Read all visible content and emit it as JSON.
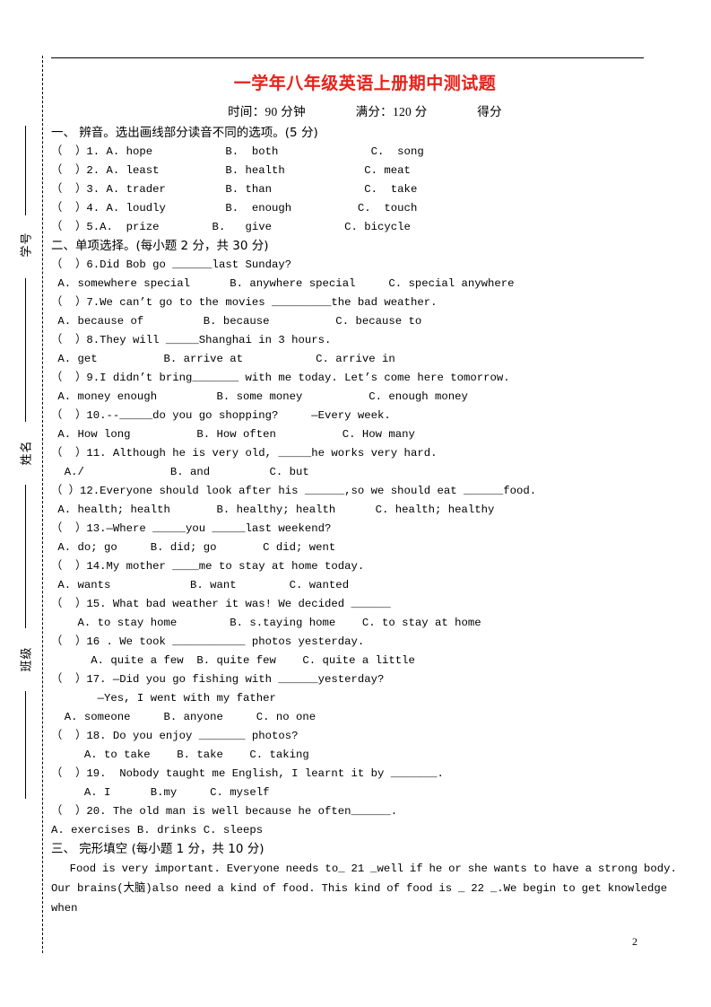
{
  "document": {
    "title": "一学年八年级英语上册期中测试题",
    "title_color": "#e8201a",
    "page_number": "2",
    "score_line": {
      "time": "时间：90 分钟",
      "full_marks": "满分：120 分",
      "score": "得分"
    }
  },
  "seal_margin": {
    "labels": [
      "学号",
      "姓名",
      "班级"
    ]
  },
  "sections": [
    {
      "heading": "一、 辨音。选出画线部分读音不同的选项。(5 分)",
      "questions": [
        {
          "stem": "（  ）1. A. hope           B.  both              C.  song",
          "options": ""
        },
        {
          "stem": "（  ）2. A. least          B. health            C. meat",
          "options": ""
        },
        {
          "stem": "（  ）3. A. trader         B. than              C.  take",
          "options": ""
        },
        {
          "stem": "（  ）4. A. loudly         B.  enough          C.  touch",
          "options": ""
        },
        {
          "stem": "（  ）5.A.  prize        B.   give           C. bicycle",
          "options": ""
        }
      ]
    },
    {
      "heading": "二、单项选择。(每小题 2 分，共 30 分)",
      "questions": [
        {
          "stem": "（  ）6.Did Bob go ______last Sunday?",
          "options": " A. somewhere special      B. anywhere special     C. special anywhere"
        },
        {
          "stem": "（  ）7.We can’t go to the movies _________the bad weather.",
          "options": " A. because of         B. because          C. because to"
        },
        {
          "stem": "（  ）8.They will _____Shanghai in 3 hours.",
          "options": " A. get          B. arrive at           C. arrive in"
        },
        {
          "stem": "（  ）9.I didn’t bring_______ with me today. Let’s come here tomorrow.",
          "options": " A. money enough         B. some money          C. enough money"
        },
        {
          "stem": "（  ）10.--_____do you go shopping?     —Every week.",
          "options": " A. How long          B. How often          C. How many"
        },
        {
          "stem": "（  ）11. Although he is very old, _____he works very hard.",
          "options": "  A./             B. and         C. but"
        },
        {
          "stem": "（ ）12.Everyone should look after his ______,so we should eat ______food.",
          "options": " A. health; health       B. healthy; health      C. health; healthy"
        },
        {
          "stem": "（  ）13.—Where _____you _____last weekend?",
          "options": " A. do; go     B. did; go       C did; went"
        },
        {
          "stem": "（  ）14.My mother ____me to stay at home today.",
          "options": " A. wants            B. want        C. wanted"
        },
        {
          "stem": "（  ）15. What bad weather it was! We decided ______",
          "options": "    A. to stay home        B. s.taying home    C. to stay at home"
        },
        {
          "stem": "（  ）16 . We took ___________ photos yesterday.",
          "options": "      A. quite a few  B. quite few    C. quite a little"
        },
        {
          "stem": "（  ）17. —Did you go fishing with ______yesterday?\n       —Yes, I went with my father",
          "options": "  A. someone     B. anyone     C. no one"
        },
        {
          "stem": "（  ）18. Do you enjoy _______ photos?",
          "options": "     A. to take    B. take    C. taking"
        },
        {
          "stem": "（  ）19.  Nobody taught me English, I learnt it by _______.",
          "options": "     A. I      B.my     C. myself"
        },
        {
          "stem": "（  ）20. The old man is well because he often______.",
          "options": "A. exercises B. drinks C. sleeps"
        }
      ]
    },
    {
      "heading": "三、 完形填空 (每小题 1 分，共 10 分)",
      "paragraph_lines": [
        "   Food is very important. Everyone needs to_ 21 _well if he or she wants to have a strong body.",
        "Our brains(大脑)also need a kind of food. This kind of food is _ 22 _.We begin to get knowledge when"
      ]
    }
  ]
}
